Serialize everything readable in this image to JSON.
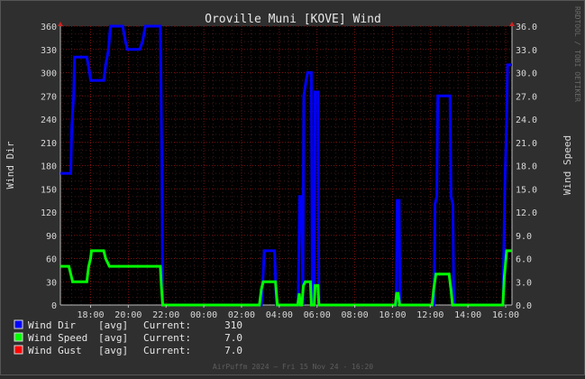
{
  "chart_data": {
    "type": "line",
    "title": "Oroville Muni [KOVE] Wind",
    "ylabel": "Wind Dir",
    "y2label": "Wind Speed",
    "side_credit": "RRDTOOL / TOBI OETIKER",
    "footer": "AirPuffm 2024 – Fri 15 Nov 24 - 16:20",
    "ylim": [
      0,
      360
    ],
    "y2lim": [
      0,
      36
    ],
    "yticks": [
      "0",
      "30",
      "60",
      "90",
      "120",
      "150",
      "180",
      "210",
      "240",
      "270",
      "300",
      "330",
      "360"
    ],
    "y2ticks": [
      "0.0",
      "3.0",
      "6.0",
      "9.0",
      "12.0",
      "15.0",
      "18.0",
      "21.0",
      "24.0",
      "27.0",
      "30.0",
      "33.0",
      "36.0"
    ],
    "xlim": [
      16.4,
      16.333
    ],
    "xlabels": [
      {
        "t": 18,
        "label": "18:00"
      },
      {
        "t": 20,
        "label": "20:00"
      },
      {
        "t": 22,
        "label": "22:00"
      },
      {
        "t": 24,
        "label": "00:00"
      },
      {
        "t": 26,
        "label": "02:00"
      },
      {
        "t": 28,
        "label": "04:00"
      },
      {
        "t": 30,
        "label": "06:00"
      },
      {
        "t": 32,
        "label": "08:00"
      },
      {
        "t": 34,
        "label": "10:00"
      },
      {
        "t": 36,
        "label": "12:00"
      },
      {
        "t": 38,
        "label": "14:00"
      },
      {
        "t": 40,
        "label": "16:00"
      }
    ],
    "series": [
      {
        "name": "Wind Dir",
        "color": "#0000ff",
        "axis": "left",
        "points": [
          [
            16.4,
            170
          ],
          [
            16.95,
            170
          ],
          [
            17.0,
            230
          ],
          [
            17.1,
            270
          ],
          [
            17.15,
            320
          ],
          [
            17.8,
            320
          ],
          [
            17.95,
            300
          ],
          [
            18.0,
            290
          ],
          [
            18.7,
            290
          ],
          [
            18.8,
            310
          ],
          [
            18.95,
            330
          ],
          [
            19.05,
            360
          ],
          [
            19.7,
            360
          ],
          [
            19.85,
            340
          ],
          [
            19.95,
            330
          ],
          [
            20.6,
            330
          ],
          [
            20.75,
            340
          ],
          [
            20.9,
            360
          ],
          [
            21.7,
            360
          ],
          [
            21.78,
            180
          ],
          [
            21.82,
            0
          ],
          [
            27.05,
            0
          ],
          [
            27.15,
            40
          ],
          [
            27.2,
            70
          ],
          [
            27.75,
            70
          ],
          [
            27.85,
            0
          ],
          [
            29.0,
            0
          ],
          [
            29.08,
            140
          ],
          [
            29.18,
            140
          ],
          [
            29.25,
            0
          ],
          [
            29.3,
            270
          ],
          [
            29.42,
            290
          ],
          [
            29.5,
            300
          ],
          [
            29.7,
            300
          ],
          [
            29.75,
            0
          ],
          [
            29.85,
            0
          ],
          [
            29.9,
            275
          ],
          [
            30.05,
            275
          ],
          [
            30.1,
            0
          ],
          [
            34.2,
            0
          ],
          [
            34.25,
            135
          ],
          [
            34.35,
            135
          ],
          [
            34.4,
            0
          ],
          [
            36.2,
            0
          ],
          [
            36.25,
            130
          ],
          [
            36.35,
            140
          ],
          [
            36.4,
            270
          ],
          [
            37.05,
            270
          ],
          [
            37.1,
            140
          ],
          [
            37.2,
            130
          ],
          [
            37.25,
            0
          ],
          [
            39.85,
            0
          ],
          [
            39.95,
            150
          ],
          [
            40.05,
            240
          ],
          [
            40.1,
            310
          ],
          [
            40.333,
            310
          ]
        ]
      },
      {
        "name": "Wind Speed",
        "color": "#00ff00",
        "axis": "right",
        "points": [
          [
            16.4,
            5
          ],
          [
            16.85,
            5
          ],
          [
            16.95,
            4
          ],
          [
            17.05,
            3
          ],
          [
            17.8,
            3
          ],
          [
            17.9,
            5
          ],
          [
            18.0,
            6
          ],
          [
            18.05,
            7
          ],
          [
            18.7,
            7
          ],
          [
            18.8,
            6
          ],
          [
            18.9,
            5.5
          ],
          [
            19.0,
            5
          ],
          [
            21.7,
            5
          ],
          [
            21.75,
            2.5
          ],
          [
            21.82,
            0
          ],
          [
            26.95,
            0
          ],
          [
            27.05,
            2
          ],
          [
            27.15,
            3
          ],
          [
            27.8,
            3
          ],
          [
            27.9,
            0
          ],
          [
            28.98,
            0
          ],
          [
            29.06,
            1.5
          ],
          [
            29.12,
            0
          ],
          [
            29.2,
            0
          ],
          [
            29.28,
            2.5
          ],
          [
            29.38,
            3
          ],
          [
            29.65,
            3
          ],
          [
            29.7,
            0
          ],
          [
            29.85,
            0
          ],
          [
            29.9,
            2.5
          ],
          [
            30.05,
            2.5
          ],
          [
            30.1,
            0
          ],
          [
            34.15,
            0
          ],
          [
            34.22,
            1.5
          ],
          [
            34.3,
            1.5
          ],
          [
            34.38,
            0
          ],
          [
            36.1,
            0
          ],
          [
            36.18,
            2
          ],
          [
            36.3,
            4
          ],
          [
            37.0,
            4
          ],
          [
            37.1,
            2
          ],
          [
            37.18,
            0
          ],
          [
            39.85,
            0
          ],
          [
            39.92,
            3.5
          ],
          [
            40.05,
            7
          ],
          [
            40.333,
            7
          ]
        ]
      },
      {
        "name": "Wind Gust",
        "color": "#ff0000",
        "axis": "right",
        "points": []
      }
    ],
    "legend": [
      {
        "swatch": "#0000ff",
        "label": "Wind Dir",
        "avg": "[avg]",
        "current_label": "Current:",
        "current": "310"
      },
      {
        "swatch": "#00ff00",
        "label": "Wind Speed",
        "avg": "[avg]",
        "current_label": "Current:",
        "current": "7.0"
      },
      {
        "swatch": "#ff0000",
        "label": "Wind Gust",
        "avg": "[avg]",
        "current_label": "Current:",
        "current": "7.0"
      }
    ]
  }
}
